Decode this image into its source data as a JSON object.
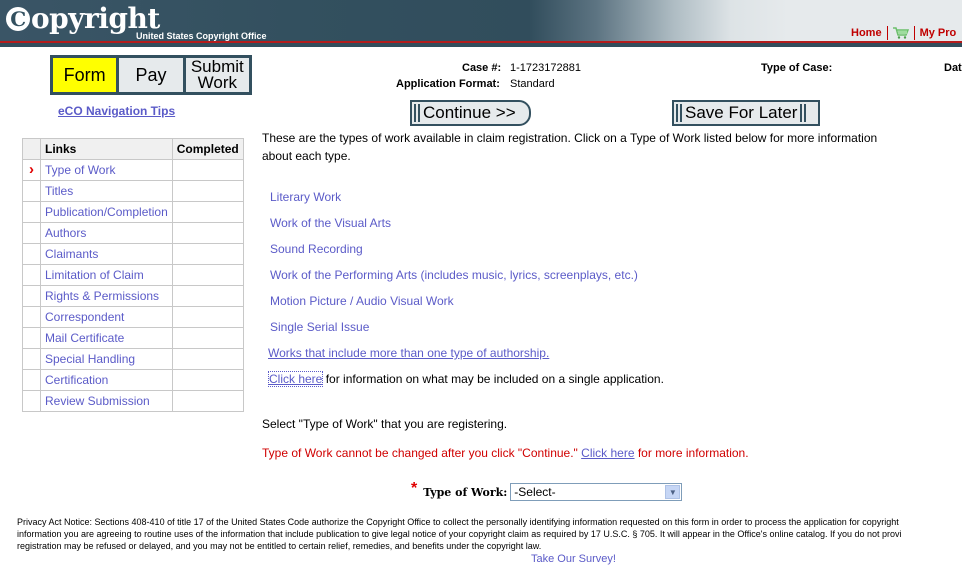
{
  "header": {
    "logo_text": "opyright",
    "logo_c": "C",
    "logo_sub": "United States Copyright Office",
    "nav": {
      "home": "Home",
      "cart_icon": "shopping-cart-icon",
      "profile": "My Pro"
    }
  },
  "steps": [
    {
      "label": "Form",
      "active": true
    },
    {
      "label": "Pay",
      "active": false
    },
    {
      "label": "Submit Work",
      "active": false
    }
  ],
  "nav_tips": "eCO Navigation Tips",
  "links_table": {
    "headers": [
      "",
      "Links",
      "Completed"
    ],
    "current_marker": "›",
    "rows": [
      {
        "label": "Type of Work",
        "current": true,
        "completed": ""
      },
      {
        "label": "Titles",
        "current": false,
        "completed": ""
      },
      {
        "label": "Publication/Completion",
        "current": false,
        "completed": ""
      },
      {
        "label": "Authors",
        "current": false,
        "completed": ""
      },
      {
        "label": "Claimants",
        "current": false,
        "completed": ""
      },
      {
        "label": "Limitation of Claim",
        "current": false,
        "completed": ""
      },
      {
        "label": "Rights & Permissions",
        "current": false,
        "completed": ""
      },
      {
        "label": "Correspondent",
        "current": false,
        "completed": ""
      },
      {
        "label": "Mail Certificate",
        "current": false,
        "completed": ""
      },
      {
        "label": "Special Handling",
        "current": false,
        "completed": ""
      },
      {
        "label": "Certification",
        "current": false,
        "completed": ""
      },
      {
        "label": "Review Submission",
        "current": false,
        "completed": ""
      }
    ]
  },
  "case_info": {
    "case_label": "Case #:",
    "case_value": "1-1723172881",
    "format_label": "Application Format:",
    "format_value": "Standard",
    "type_label": "Type of Case:",
    "type_value": "",
    "date_label": "Dat"
  },
  "buttons": {
    "continue": "Continue >>",
    "save": "Save For Later"
  },
  "intro": "These are the types of work available in claim registration. Click on a Type of Work listed below for more information about each type.",
  "work_types": [
    "Literary Work",
    "Work of the Visual Arts",
    "Sound Recording",
    "Work of the Performing Arts (includes music, lyrics, screenplays, etc.)",
    "Motion Picture / Audio Visual Work",
    "Single Serial Issue"
  ],
  "multi_authorship_link": "Works that include more than one type of authorship.",
  "click_here_row": {
    "link": "Click here",
    "text": " for information on what may be included on a single application."
  },
  "select_instruction": "Select \"Type of Work\" that you are registering.",
  "warning": {
    "text": "Type of Work cannot be changed after you click \"Continue.\" ",
    "link": "Click here",
    "after": " for more information."
  },
  "type_of_work": {
    "required_marker": "*",
    "label": "Type of Work:",
    "selected": "-Select-"
  },
  "privacy_notice": [
    "Privacy Act Notice: Sections 408-410 of title 17 of the United States Code authorize the Copyright Office to collect the personally identifying information requested on this form in order to process the application for copyright",
    "information you are agreeing to routine uses of the information that include publication to give legal notice of your copyright claim as required by 17 U.S.C. § 705. It will appear in the Office's online catalog. If you do not provi",
    "registration may be refused or delayed, and you may not be entitled to certain relief, remedies, and benefits under the copyright law."
  ],
  "survey_link": "Take Our Survey!"
}
